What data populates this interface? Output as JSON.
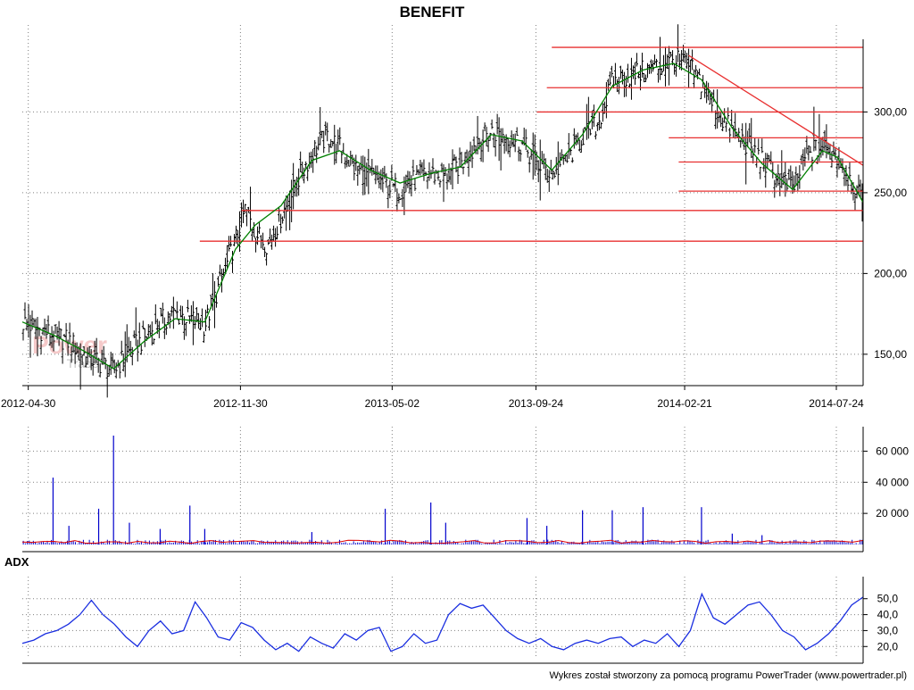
{
  "chart_data": {
    "title": "BENEFIT",
    "footer": "Wykres został stworzony za pomocą programu PowerTrader (www.powertrader.pl)",
    "watermark": "PowerTrader",
    "colors": {
      "price": "#000000",
      "ma": "#008000",
      "levels": "#e83030",
      "volume": "#0000cc",
      "volume_ma": "#e00000",
      "adx": "#1a2ee0",
      "grid": "#808080"
    },
    "price_panel": {
      "type": "ohlc",
      "ylim": [
        135,
        345
      ],
      "y_ticks": [
        150,
        200,
        250,
        300
      ],
      "y_tick_labels": [
        "150,00",
        "200,00",
        "250,00",
        "300,00"
      ],
      "x_tick_labels": [
        "2012-04-30",
        "2012-11-30",
        "2013-05-02",
        "2013-09-24",
        "2014-02-21",
        "2014-07-24"
      ],
      "x_range": [
        "2012-04-24",
        "2014-08-20"
      ],
      "series": {
        "name": "",
        "x": [
          "2012-04-24",
          "2012-05-10",
          "2012-05-25",
          "2012-06-10",
          "2012-06-25",
          "2012-07-10",
          "2012-07-25",
          "2012-08-10",
          "2012-08-25",
          "2012-09-10",
          "2012-09-25",
          "2012-10-10",
          "2012-10-25",
          "2012-11-10",
          "2012-11-25",
          "2012-12-05",
          "2012-12-15",
          "2012-12-28",
          "2013-01-10",
          "2013-01-25",
          "2013-02-10",
          "2013-02-25",
          "2013-03-10",
          "2013-03-25",
          "2013-04-10",
          "2013-04-25",
          "2013-05-10",
          "2013-05-25",
          "2013-06-10",
          "2013-06-25",
          "2013-07-10",
          "2013-07-25",
          "2013-08-10",
          "2013-08-25",
          "2013-09-10",
          "2013-09-25",
          "2013-10-10",
          "2013-10-25",
          "2013-11-10",
          "2013-11-25",
          "2013-12-10",
          "2013-12-25",
          "2014-01-10",
          "2014-01-25",
          "2014-02-10",
          "2014-02-25",
          "2014-03-10",
          "2014-03-25",
          "2014-04-10",
          "2014-04-25",
          "2014-05-10",
          "2014-05-25",
          "2014-06-10",
          "2014-06-25",
          "2014-07-10",
          "2014-07-25",
          "2014-08-10",
          "2014-08-20"
        ],
        "close": [
          170,
          166,
          162,
          158,
          150,
          145,
          140,
          152,
          160,
          170,
          175,
          172,
          168,
          195,
          220,
          240,
          225,
          218,
          235,
          255,
          275,
          285,
          278,
          265,
          260,
          255,
          252,
          258,
          262,
          260,
          268,
          280,
          288,
          285,
          280,
          268,
          262,
          270,
          285,
          292,
          318,
          322,
          325,
          328,
          332,
          328,
          318,
          300,
          288,
          280,
          270,
          260,
          252,
          275,
          278,
          272,
          255,
          242
        ]
      },
      "ma_series": {
        "name": "",
        "x": [
          "2012-04-24",
          "2012-05-25",
          "2012-06-25",
          "2012-07-25",
          "2012-08-25",
          "2012-09-25",
          "2012-10-25",
          "2012-11-25",
          "2012-12-15",
          "2013-01-10",
          "2013-02-10",
          "2013-03-10",
          "2013-04-10",
          "2013-05-10",
          "2013-06-10",
          "2013-07-10",
          "2013-08-10",
          "2013-09-10",
          "2013-10-10",
          "2013-11-10",
          "2013-12-10",
          "2014-01-10",
          "2014-02-10",
          "2014-03-10",
          "2014-04-10",
          "2014-05-10",
          "2014-06-10",
          "2014-07-10",
          "2014-07-25",
          "2014-08-20"
        ],
        "values": [
          170,
          162,
          152,
          141,
          158,
          172,
          170,
          215,
          230,
          242,
          270,
          276,
          264,
          256,
          262,
          266,
          286,
          282,
          264,
          286,
          316,
          326,
          330,
          320,
          290,
          268,
          252,
          276,
          272,
          244
        ]
      },
      "horizontal_levels": [
        {
          "value": 340,
          "from": "2013-10-10",
          "to": "2014-08-20"
        },
        {
          "value": 315,
          "from": "2013-10-05",
          "to": "2014-08-20"
        },
        {
          "value": 300,
          "from": "2013-09-25",
          "to": "2014-08-20"
        },
        {
          "value": 284,
          "from": "2014-02-05",
          "to": "2014-08-20"
        },
        {
          "value": 269,
          "from": "2014-02-15",
          "to": "2014-08-20"
        },
        {
          "value": 251,
          "from": "2014-02-15",
          "to": "2014-08-20"
        },
        {
          "value": 239,
          "from": "2012-12-01",
          "to": "2014-08-20"
        },
        {
          "value": 220,
          "from": "2012-10-20",
          "to": "2014-08-20"
        }
      ],
      "trend_lines": [
        {
          "from": [
            "2014-02-25",
            335
          ],
          "to": [
            "2014-08-20",
            267
          ]
        }
      ]
    },
    "volume_panel": {
      "type": "bar",
      "ylim": [
        0,
        70000
      ],
      "y_ticks": [
        20000,
        40000,
        60000
      ],
      "y_tick_labels": [
        "20 000",
        "40 000",
        "60 000"
      ],
      "spikes": [
        {
          "x": "2012-05-25",
          "value": 43000
        },
        {
          "x": "2012-06-10",
          "value": 12000
        },
        {
          "x": "2012-07-10",
          "value": 23000
        },
        {
          "x": "2012-07-25",
          "value": 70000
        },
        {
          "x": "2012-08-10",
          "value": 14000
        },
        {
          "x": "2012-09-10",
          "value": 10000
        },
        {
          "x": "2012-10-10",
          "value": 25000
        },
        {
          "x": "2012-10-25",
          "value": 10000
        },
        {
          "x": "2013-02-10",
          "value": 8000
        },
        {
          "x": "2013-04-25",
          "value": 23000
        },
        {
          "x": "2013-06-10",
          "value": 27000
        },
        {
          "x": "2013-06-25",
          "value": 14000
        },
        {
          "x": "2013-09-15",
          "value": 17000
        },
        {
          "x": "2013-10-05",
          "value": 12000
        },
        {
          "x": "2013-11-10",
          "value": 22000
        },
        {
          "x": "2013-12-10",
          "value": 22000
        },
        {
          "x": "2014-01-10",
          "value": 24000
        },
        {
          "x": "2014-03-10",
          "value": 24000
        },
        {
          "x": "2014-04-10",
          "value": 7000
        },
        {
          "x": "2014-05-10",
          "value": 6000
        }
      ],
      "ma_level": 1800
    },
    "adx_panel": {
      "label": "ADX",
      "type": "line",
      "ylim": [
        14,
        56
      ],
      "y_ticks": [
        20,
        30,
        40,
        50
      ],
      "y_tick_labels": [
        "20,0",
        "30,0",
        "40,0",
        "50,0"
      ],
      "series": {
        "name": "",
        "x": [
          "2012-04-24",
          "2012-05-10",
          "2012-05-25",
          "2012-06-10",
          "2012-06-25",
          "2012-07-10",
          "2012-07-25",
          "2012-08-10",
          "2012-08-25",
          "2012-09-10",
          "2012-09-25",
          "2012-10-10",
          "2012-10-25",
          "2012-11-10",
          "2012-11-25",
          "2012-12-05",
          "2012-12-20",
          "2013-01-05",
          "2013-01-20",
          "2013-02-05",
          "2013-02-20",
          "2013-03-05",
          "2013-03-20",
          "2013-04-05",
          "2013-04-20",
          "2013-05-05",
          "2013-05-20",
          "2013-06-05",
          "2013-06-20",
          "2013-07-05",
          "2013-07-20",
          "2013-08-05",
          "2013-08-20",
          "2013-09-05",
          "2013-09-20",
          "2013-10-05",
          "2013-10-20",
          "2013-11-05",
          "2013-11-20",
          "2013-12-05",
          "2013-12-20",
          "2014-01-05",
          "2014-01-20",
          "2014-02-05",
          "2014-02-20",
          "2014-03-05",
          "2014-03-20",
          "2014-04-05",
          "2014-04-20",
          "2014-05-05",
          "2014-05-20",
          "2014-06-05",
          "2014-06-20",
          "2014-07-05",
          "2014-07-20",
          "2014-08-05",
          "2014-08-20"
        ],
        "values": [
          22,
          24,
          28,
          30,
          34,
          40,
          49,
          40,
          34,
          26,
          20,
          30,
          36,
          28,
          30,
          48,
          38,
          26,
          24,
          35,
          32,
          24,
          18,
          22,
          17,
          26,
          22,
          19,
          28,
          24,
          30,
          32,
          17,
          20,
          28,
          22,
          24,
          40,
          47,
          44,
          46,
          38,
          30,
          25,
          22,
          25,
          20,
          18,
          22,
          24,
          22,
          25,
          26,
          20,
          24,
          22,
          28,
          20,
          30,
          53,
          38,
          34,
          40,
          46,
          48,
          40,
          30,
          26,
          18,
          22,
          28,
          36,
          46,
          51
        ]
      }
    }
  }
}
